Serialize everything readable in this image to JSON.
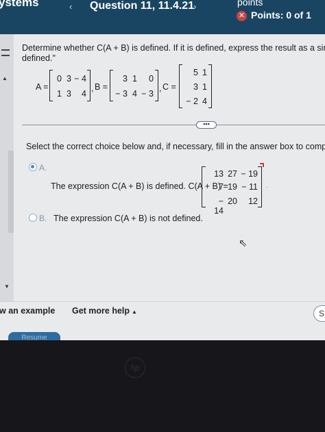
{
  "header": {
    "brand": "ystems",
    "prev_glyph": "‹",
    "question_title": "Question 11, 11.4.21",
    "next_glyph": "›",
    "points_label": "points",
    "points_value": "Points: 0 of 1"
  },
  "question": {
    "prompt_line1": "Determine whether C(A + B) is defined. If it is defined, express the result as a single matrix",
    "prompt_line2": "defined.\"",
    "matrix_a_label": "A =",
    "matrix_a": [
      [
        "0",
        "3",
        "− 4"
      ],
      [
        "1",
        "3",
        "4"
      ]
    ],
    "matrix_b_label": "B =",
    "matrix_b": [
      [
        "3",
        "1",
        "0"
      ],
      [
        "− 3",
        "4",
        "− 3"
      ]
    ],
    "matrix_c_label": "C =",
    "matrix_c": [
      [
        "5",
        "1"
      ],
      [
        "3",
        "1"
      ],
      [
        "− 2",
        "4"
      ]
    ],
    "comma": ","
  },
  "more_button": "•••",
  "instruction": "Select the correct choice below and, if necessary, fill in the answer box to complete your cho",
  "options": [
    {
      "letter": "A.",
      "text": "The expression C(A + B) is defined. C(A + B) =",
      "selected": true,
      "answer": [
        [
          "13",
          "27",
          "− 19"
        ],
        [
          "7",
          "19",
          "− 11"
        ],
        [
          "− 14",
          "20",
          "12"
        ]
      ]
    },
    {
      "letter": "B.",
      "text": "The expression C(A + B) is not defined.",
      "selected": false
    }
  ],
  "footer": {
    "example_link": "w an example",
    "help_link": "Get more help",
    "help_caret": "▲",
    "s_button": "S",
    "resume_button": "Resume"
  },
  "icons": {
    "cursor": "arrow-pointer",
    "close": "x-circle",
    "menu": "lines",
    "rail_up": "triangle-up",
    "rail_down": "triangle-down"
  },
  "colors": {
    "header_bg": "#1a4562",
    "content_bg": "#e9eaec",
    "radio_selected": "#4a86b4",
    "badge_red": "#c94444"
  }
}
